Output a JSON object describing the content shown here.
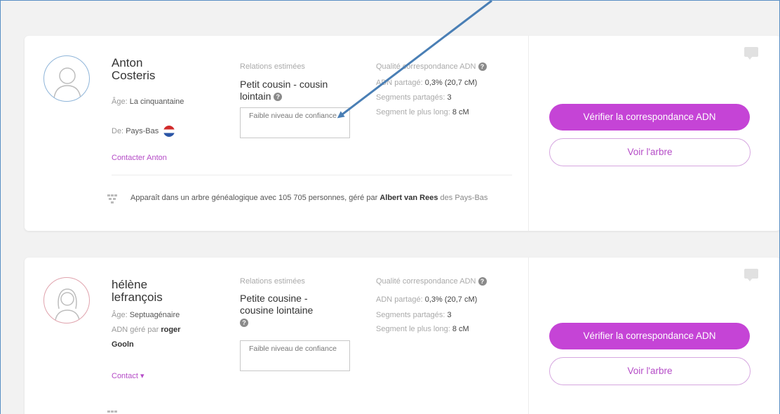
{
  "matches": [
    {
      "name": "Anton Costeris",
      "age_label": "Âge:",
      "age_value": "La cinquantaine",
      "origin_label": "De:",
      "origin_value": "Pays-Bas",
      "contact_label": "Contacter Anton",
      "relation_title": "Relations estimées",
      "relation_value": "Petit cousin - cousin lointain",
      "confidence": "Faible niveau de confiance",
      "dna_title": "Qualité correspondance ADN",
      "shared_label": "ADN partagé:",
      "shared_value": "0,3% (20,7 cM)",
      "segments_label": "Segments partagés:",
      "segments_value": "3",
      "longest_label": "Segment le plus long:",
      "longest_value": "8 cM",
      "primary_btn": "Vérifier la correspondance ADN",
      "secondary_btn": "Voir l'arbre",
      "tree_text_1": "Apparaît dans un arbre généalogique avec 105 705 personnes, géré par",
      "tree_manager": "Albert van Rees",
      "tree_text_2": "des Pays-Bas"
    },
    {
      "name": "hélène lefrançois",
      "age_label": "Âge:",
      "age_value": "Septuagénaire",
      "managed_label": "ADN géré par",
      "managed_value": "roger Gooln",
      "contact_label": "Contact ▾",
      "relation_title": "Relations estimées",
      "relation_value": "Petite cousine - cousine lointaine",
      "confidence": "Faible niveau de confiance",
      "dna_title": "Qualité correspondance ADN",
      "shared_label": "ADN partagé:",
      "shared_value": "0,3% (20,7 cM)",
      "segments_label": "Segments partagés:",
      "segments_value": "3",
      "longest_label": "Segment le plus long:",
      "longest_value": "8 cM",
      "primary_btn": "Vérifier la correspondance ADN",
      "secondary_btn": "Voir l'arbre"
    }
  ],
  "colors": {
    "accent": "#c544d6",
    "annotation_arrow": "#4a7fb5",
    "avatar_male_ring": "#8fb5d9",
    "avatar_female_ring": "#e0a3ad"
  }
}
